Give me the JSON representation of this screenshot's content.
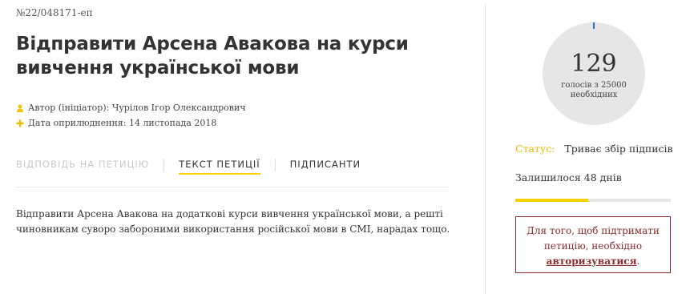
{
  "petition": {
    "number": "№22/048171-еп",
    "title": "Відправити Арсена Авакова на курси вивчення української мови",
    "author": "Автор (ініціатор): Чурілов Ігор Олександрович",
    "date": "Дата оприлюднення: 14 листопада 2018",
    "body": "Відправити Арсена Авакова на додаткові курси вивчення української мови, а решті чиновникам суворо забороними використання російської мови в СМІ, нарадах тощо."
  },
  "icons": {
    "author": "person-icon",
    "date": "plus-icon"
  },
  "tabs": [
    {
      "label": "ВІДПОВІДЬ НА ПЕТИЦІЮ",
      "state": "disabled"
    },
    {
      "label": "ТЕКСТ ПЕТИЦІЇ",
      "state": "active"
    },
    {
      "label": "ПІДПИСАНТИ",
      "state": "normal"
    }
  ],
  "sidebar": {
    "votes": "129",
    "votes_label": "голосів з 25000 необхідних",
    "votes_fraction": 0.00516,
    "status_label": "Статус:",
    "status_value": "Триває збір підписів",
    "days_left": "Залишилося 48 днів",
    "time_progress_percent": 47,
    "auth_text_prefix": "Для того, щоб підтримати петицію, необхідно ",
    "auth_link": "авторизуватися",
    "auth_text_suffix": "."
  },
  "colors": {
    "accent": "#ffd200",
    "status_label": "#e6b800",
    "auth": "#8a2c2c",
    "counter_bg": "#e6e6e6",
    "counter_tick": "#2c6fbf"
  }
}
